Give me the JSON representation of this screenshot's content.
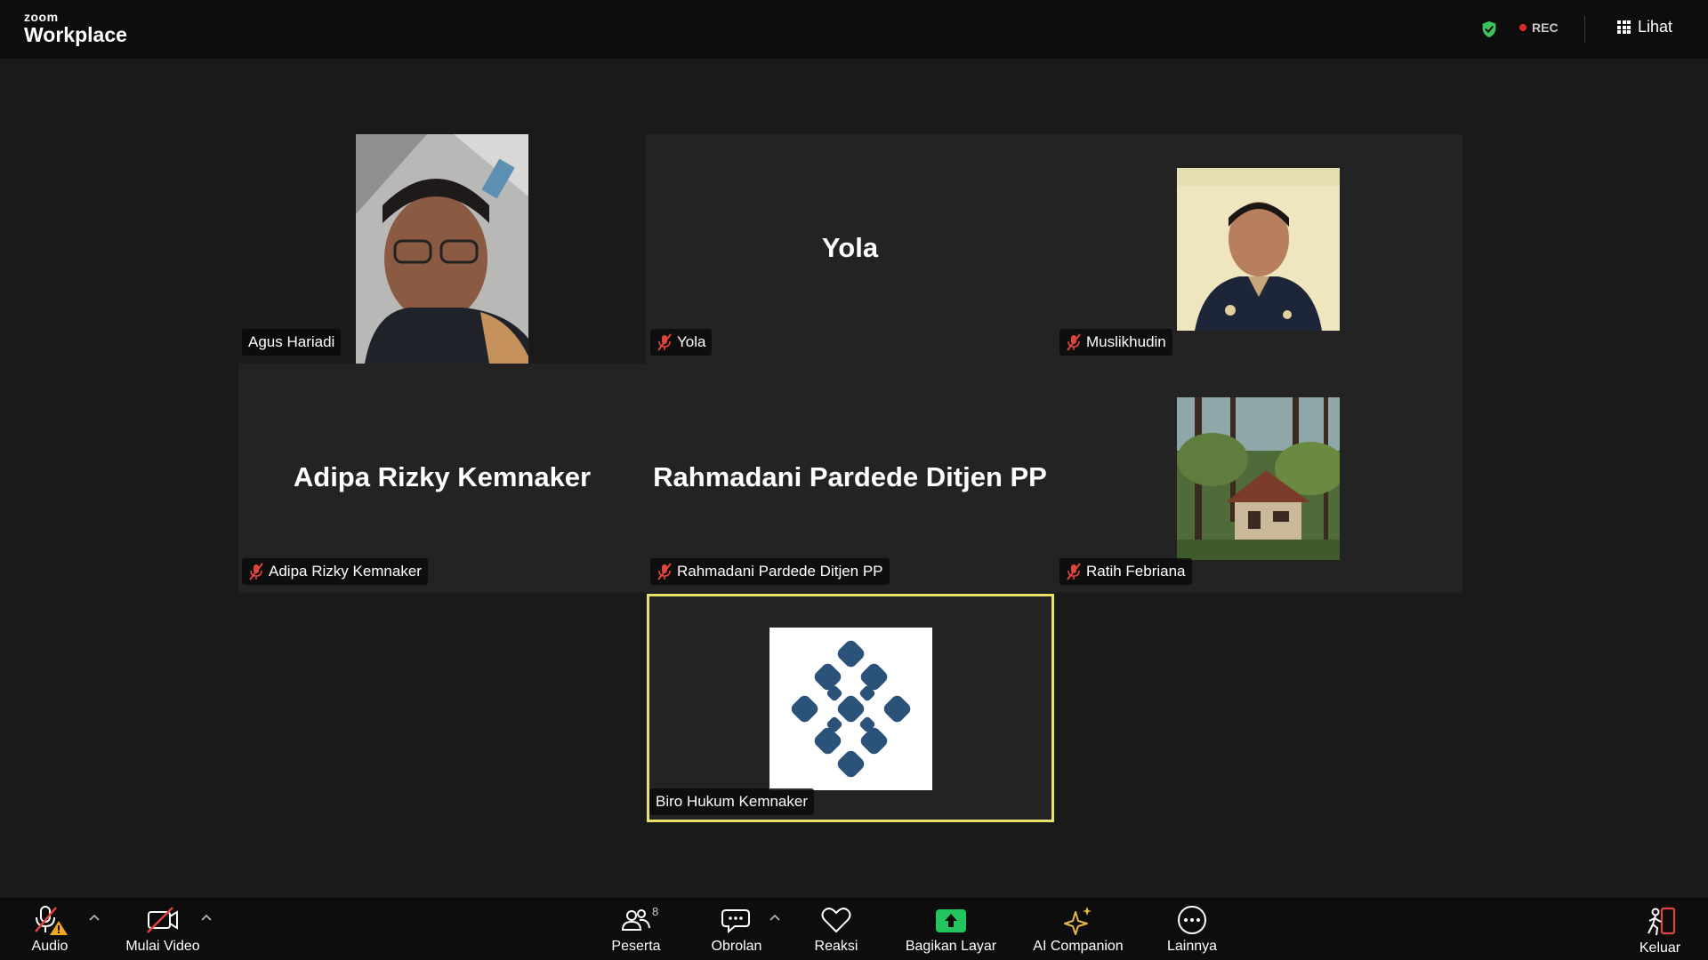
{
  "app": {
    "brand_small": "zoom",
    "brand_big": "Workplace"
  },
  "topbar": {
    "rec_label": "REC",
    "view_label": "Lihat",
    "shield_color": "#3cc35c"
  },
  "participants": [
    {
      "name": "Agus Hariadi",
      "video": true,
      "muted": false
    },
    {
      "name": "Yola",
      "video": false,
      "muted": true
    },
    {
      "name": "Muslikhudin",
      "video": true,
      "muted": true
    },
    {
      "name": "Adipa Rizky Kemnaker",
      "video": false,
      "muted": true
    },
    {
      "name": "Rahmadani Pardede Ditjen PP",
      "video": false,
      "muted": true
    },
    {
      "name": "Ratih Febriana",
      "video": true,
      "muted": true
    },
    {
      "name": "Biro Hukum Kemnaker",
      "video": true,
      "muted": false,
      "active_speaker": true
    }
  ],
  "toolbar": {
    "audio": "Audio",
    "video": "Mulai Video",
    "participants": "Peserta",
    "participants_count": "8",
    "chat": "Obrolan",
    "reactions": "Reaksi",
    "share": "Bagikan Layar",
    "ai": "AI Companion",
    "more": "Lainnya",
    "leave": "Keluar"
  },
  "colors": {
    "active_outline": "#e8e26a",
    "share_green": "#22c55e",
    "ai_gold": "#e6b84a",
    "muted_red": "#e0443c",
    "leave_red": "#e0443c",
    "logo_blue": "#2b5279"
  }
}
